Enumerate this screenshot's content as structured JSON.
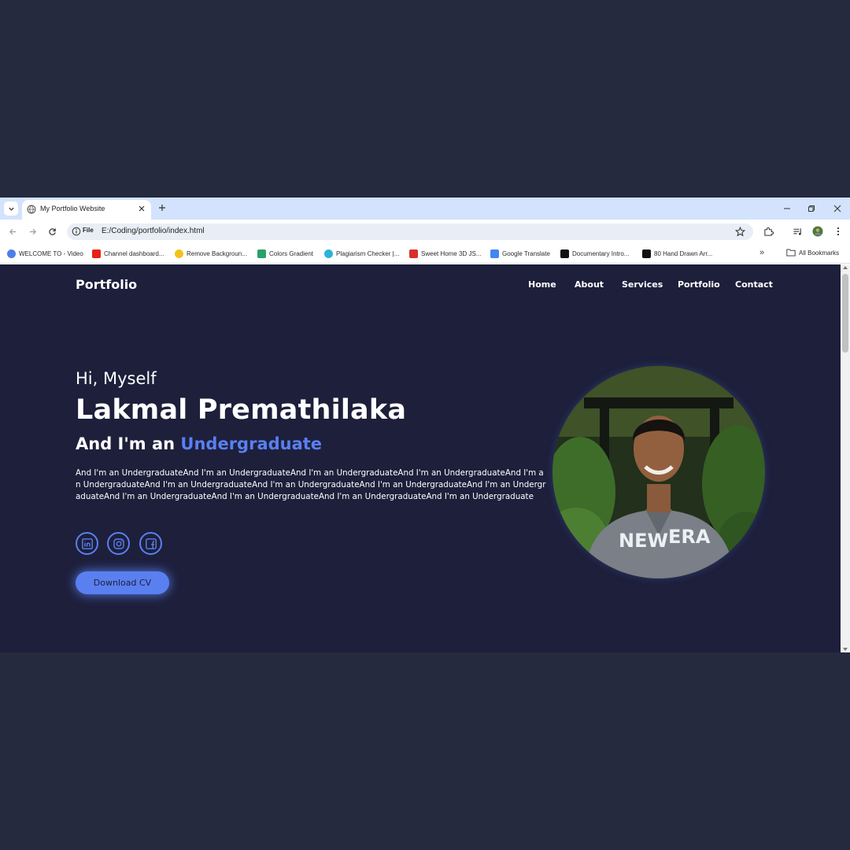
{
  "browser": {
    "tab_title": "My Portfolio Website",
    "address_chip": "File",
    "url": "E:/Coding/portfolio/index.html",
    "bookmarks": [
      {
        "label": "WELCOME TO - Video",
        "color": "#4d7ee8"
      },
      {
        "label": "Channel dashboard...",
        "color": "#e62117"
      },
      {
        "label": "Remove Backgroun...",
        "color": "#f2c21b"
      },
      {
        "label": "Colors Gradient",
        "color": "#2aa06a"
      },
      {
        "label": "Plagiarism Checker |...",
        "color": "#2bb3d9"
      },
      {
        "label": "Sweet Home 3D JS...",
        "color": "#d7312c"
      },
      {
        "label": "Google Translate",
        "color": "#4285f4"
      },
      {
        "label": "Documentary Intro...",
        "color": "#111111"
      },
      {
        "label": "80 Hand Drawn Arr...",
        "color": "#111111"
      }
    ],
    "more_bookmarks": "»",
    "all_bookmarks": "All Bookmarks"
  },
  "site": {
    "logo": "Portfolio",
    "nav": [
      "Home",
      "About",
      "Services",
      "Portfolio",
      "Contact"
    ],
    "greeting": "Hi, Myself",
    "name": "Lakmal Premathilaka",
    "role_prefix": "And I'm an ",
    "role_highlight": "Undergraduate",
    "description": "And I'm an UndergraduateAnd I'm an UndergraduateAnd I'm an UndergraduateAnd I'm an UndergraduateAnd I'm an UndergraduateAnd I'm an UndergraduateAnd I'm an UndergraduateAnd I'm an UndergraduateAnd I'm an UndergraduateAnd I'm an UndergraduateAnd I'm an UndergraduateAnd I'm an UndergraduateAnd I'm an Undergraduate",
    "social_icons": [
      "linkedin-icon",
      "instagram-icon",
      "facebook-icon"
    ],
    "cv_button": "Download CV",
    "accent_color": "#5a7ff0",
    "background_color": "#1d1f3b"
  }
}
